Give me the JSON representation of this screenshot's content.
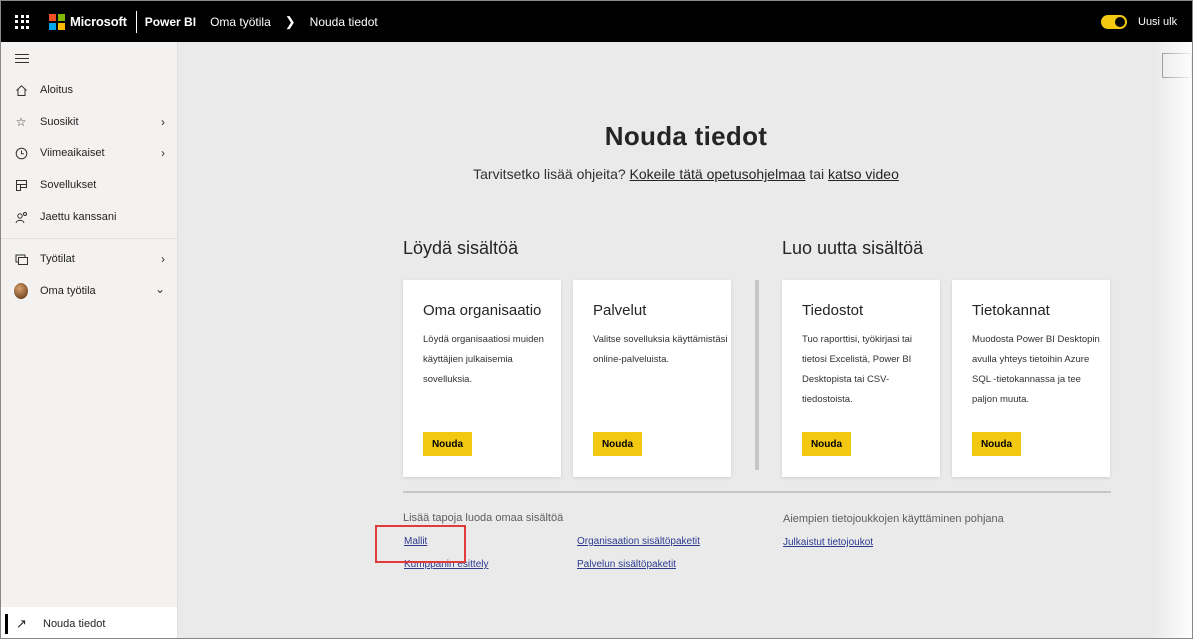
{
  "topbar": {
    "brand": "Microsoft",
    "product": "Power BI",
    "breadcrumb": [
      "Oma työtila",
      "Nouda tiedot"
    ],
    "toggle_label": "Uusi ulk",
    "ms_colors": [
      "#f25022",
      "#7fba00",
      "#00a4ef",
      "#ffb900"
    ]
  },
  "sidebar": {
    "items": [
      {
        "label": "Aloitus",
        "icon": "home-icon"
      },
      {
        "label": "Suosikit",
        "icon": "star-icon",
        "expandable": true
      },
      {
        "label": "Viimeaikaiset",
        "icon": "clock-icon",
        "expandable": true
      },
      {
        "label": "Sovellukset",
        "icon": "apps-icon"
      },
      {
        "label": "Jaettu kanssani",
        "icon": "shared-icon"
      },
      {
        "label": "Työtilat",
        "icon": "workspaces-icon",
        "expandable": true
      },
      {
        "label": "Oma työtila",
        "icon": "avatar",
        "expandable": true
      }
    ],
    "bottom": {
      "label": "Nouda tiedot",
      "icon": "arrow-up-right-icon"
    }
  },
  "main": {
    "title": "Nouda tiedot",
    "subtitle_prefix": "Tarvitsetko lisää ohjeita?",
    "subtitle_link1": "Kokeile tätä opetusohjelmaa",
    "subtitle_mid": "tai",
    "subtitle_link2": "katso video",
    "discover_heading": "Löydä sisältöä",
    "create_heading": "Luo uutta sisältöä",
    "cards": [
      {
        "title": "Oma organisaatio",
        "desc": "Löydä organisaatiosi muiden käyttäjien julkaisemia sovelluksia.",
        "button": "Nouda"
      },
      {
        "title": "Palvelut",
        "desc": "Valitse sovelluksia käyttämistäsi online-palveluista.",
        "button": "Nouda"
      },
      {
        "title": "Tiedostot",
        "desc": "Tuo raporttisi, työkirjasi tai tietosi Excelistä, Power BI Desktopista tai CSV-tiedostoista.",
        "button": "Nouda"
      },
      {
        "title": "Tietokannat",
        "desc": "Muodosta Power BI Desktopin avulla yhteys tietoihin Azure SQL -tietokannassa ja tee paljon muuta.",
        "button": "Nouda"
      }
    ],
    "more": {
      "heading_left": "Lisää tapoja luoda omaa sisältöä",
      "links_left_col1": [
        "Mallit",
        "Kumppanin esittely"
      ],
      "links_left_col2": [
        "Organisaation sisältöpaketit",
        "Palvelun sisältöpaketit"
      ],
      "heading_right": "Aiempien tietojoukkojen käyttäminen pohjana",
      "links_right": [
        "Julkaistut tietojoukot"
      ]
    }
  }
}
